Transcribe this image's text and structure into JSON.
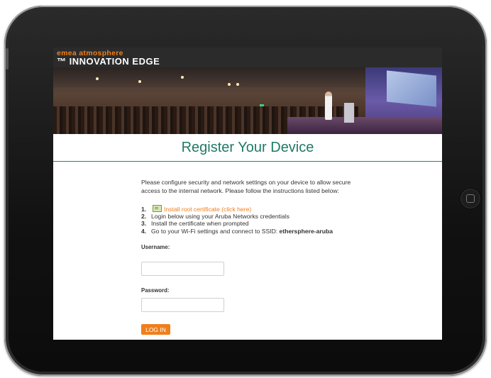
{
  "brand": {
    "line1": "emea atmosphere",
    "line2": "™ INNOVATION EDGE",
    "accent_color": "#f07e1b"
  },
  "page": {
    "title": "Register Your Device",
    "title_color": "#1f7a66",
    "intro": "Please configure security and network settings on your device to allow secure access to the internal network. Please follow the instructions listed below:"
  },
  "steps": [
    {
      "num": "1.",
      "link_text": "Install root certificate (click here)",
      "icon": "certificate-icon"
    },
    {
      "num": "2.",
      "text": "Login below using your Aruba Networks credentials"
    },
    {
      "num": "3.",
      "text": "Install the certificate when prompted"
    },
    {
      "num": "4.",
      "text": "Go to your Wi-Fi settings and connect to SSID: ",
      "ssid": "ethersphere-aruba"
    }
  ],
  "form": {
    "username_label": "Username:",
    "username_value": "",
    "password_label": "Password:",
    "password_value": "",
    "login_label": "LOG IN"
  }
}
